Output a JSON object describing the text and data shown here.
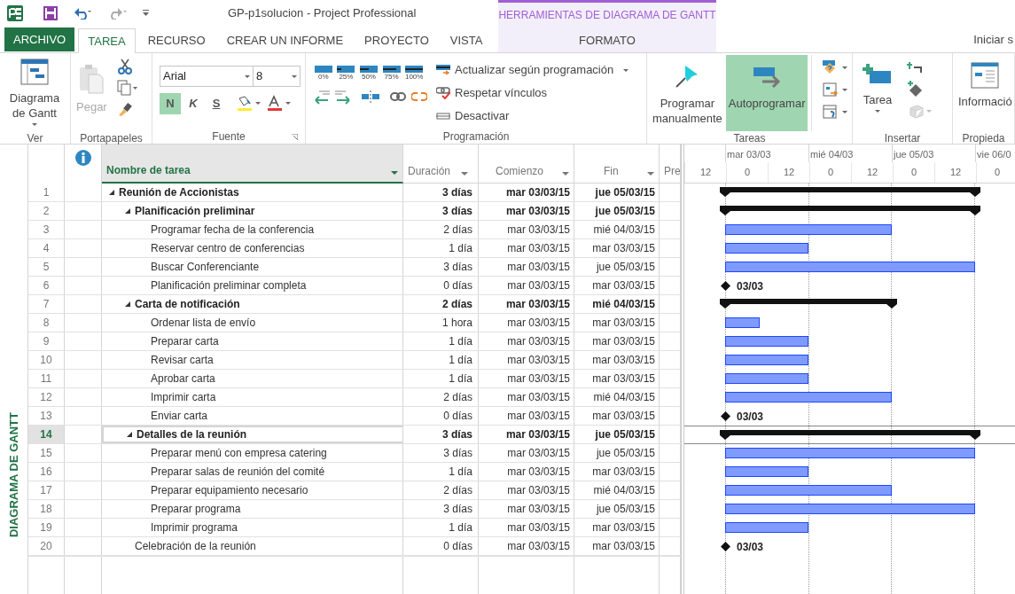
{
  "window": {
    "title": "GP-p1solucion - Project Professional"
  },
  "contextual_group": {
    "label": "HERRAMIENTAS DE DIAGRAMA DE GANTT"
  },
  "tabs": [
    {
      "label": "ARCHIVO",
      "kind": "file",
      "selected": false
    },
    {
      "label": "TAREA",
      "kind": "main",
      "selected": true
    },
    {
      "label": "RECURSO",
      "kind": "main",
      "selected": false
    },
    {
      "label": "CREAR UN INFORME",
      "kind": "main",
      "selected": false
    },
    {
      "label": "PROYECTO",
      "kind": "main",
      "selected": false
    },
    {
      "label": "VISTA",
      "kind": "main",
      "selected": false
    },
    {
      "label": "FORMATO",
      "kind": "contextual",
      "selected": false
    }
  ],
  "account_link": "Iniciar s",
  "ribbon_groups": [
    {
      "kind": "view",
      "label": "Ver",
      "buttons": [
        {
          "label": "Diagrama de Gantt",
          "dropdown": true
        }
      ]
    },
    {
      "kind": "clipboard",
      "label": "Portapapeles",
      "buttons": [
        {
          "label": "Pegar",
          "disabled": true
        }
      ]
    },
    {
      "kind": "font",
      "label": "Fuente",
      "font": "Arial",
      "size": "8",
      "styles": [
        {
          "label": "N",
          "selected": true
        },
        {
          "label": "K",
          "selected": false
        },
        {
          "label": "S",
          "selected": false
        }
      ]
    },
    {
      "kind": "schedule",
      "label": "Programación",
      "percents": [
        "0%",
        "25%",
        "50%",
        "75%",
        "100%"
      ],
      "commands": [
        {
          "label": "Actualizar según programación",
          "dropdown": true
        },
        {
          "label": "Respetar vínculos",
          "dropdown": false
        },
        {
          "label": "Desactivar",
          "dropdown": false
        }
      ]
    },
    {
      "kind": "tasks",
      "label": "Tareas",
      "buttons": [
        {
          "label": "Programar manualmente",
          "selected": false
        },
        {
          "label": "Autoprogramar",
          "selected": true
        }
      ]
    },
    {
      "kind": "insert",
      "label": "Insertar",
      "buttons": [
        {
          "label": "Tarea",
          "dropdown": true
        }
      ]
    },
    {
      "kind": "properties",
      "label": "Propieda",
      "buttons": [
        {
          "label": "Informació"
        }
      ]
    }
  ],
  "side_label": "DIAGRAMA DE GANTT",
  "columns": [
    {
      "label": "Nombre de tarea",
      "selected": true,
      "dropdown": true
    },
    {
      "label": "Duración",
      "selected": false,
      "dropdown": true
    },
    {
      "label": "Comienzo",
      "selected": false,
      "dropdown": true
    },
    {
      "label": "Fin",
      "selected": false,
      "dropdown": true
    },
    {
      "label": "Pre",
      "selected": false
    }
  ],
  "timescale": {
    "days": [
      "mar 03/03",
      "mié 04/03",
      "jue 05/03",
      "vie 06/0"
    ],
    "hours": [
      "12",
      "0",
      "12",
      "0",
      "12",
      "0",
      "12",
      "0"
    ]
  },
  "rows": [
    {
      "id": "1",
      "name": "Reunión de Accionistas",
      "duration": "3 días",
      "start": "mar 03/03/15",
      "finish": "jue 05/03/15",
      "kind": "summary",
      "expanded": true,
      "selected": false,
      "children": [
        {
          "id": "2",
          "name": "Planificación preliminar",
          "duration": "3 días",
          "start": "mar 03/03/15",
          "finish": "jue 05/03/15",
          "kind": "summary",
          "expanded": true,
          "selected": false,
          "children": [
            {
              "id": "3",
              "name": "Programar fecha de la conferencia",
              "duration": "2 días",
              "start": "mar 03/03/15",
              "finish": "mié 04/03/15",
              "kind": "task",
              "selected": false
            },
            {
              "id": "4",
              "name": "Reservar centro de conferencias",
              "duration": "1 día",
              "start": "mar 03/03/15",
              "finish": "mar 03/03/15",
              "kind": "task",
              "selected": false
            },
            {
              "id": "5",
              "name": "Buscar Conferenciante",
              "duration": "3 días",
              "start": "mar 03/03/15",
              "finish": "jue 05/03/15",
              "kind": "task",
              "selected": false
            },
            {
              "id": "6",
              "name": "Planificación preliminar completa",
              "duration": "0 días",
              "start": "mar 03/03/15",
              "finish": "mar 03/03/15",
              "kind": "milestone",
              "bar_label": "03/03",
              "selected": false
            }
          ]
        },
        {
          "id": "7",
          "name": "Carta de notificación",
          "duration": "2 días",
          "start": "mar 03/03/15",
          "finish": "mié 04/03/15",
          "kind": "summary",
          "expanded": true,
          "selected": false,
          "children": [
            {
              "id": "8",
              "name": "Ordenar lista de envío",
              "duration": "1 hora",
              "start": "mar 03/03/15",
              "finish": "mar 03/03/15",
              "kind": "task",
              "selected": false
            },
            {
              "id": "9",
              "name": "Preparar carta",
              "duration": "1 día",
              "start": "mar 03/03/15",
              "finish": "mar 03/03/15",
              "kind": "task",
              "selected": false
            },
            {
              "id": "10",
              "name": "Revisar carta",
              "duration": "1 día",
              "start": "mar 03/03/15",
              "finish": "mar 03/03/15",
              "kind": "task",
              "selected": false
            },
            {
              "id": "11",
              "name": "Aprobar carta",
              "duration": "1 día",
              "start": "mar 03/03/15",
              "finish": "mar 03/03/15",
              "kind": "task",
              "selected": false
            },
            {
              "id": "12",
              "name": "Imprimir carta",
              "duration": "2 días",
              "start": "mar 03/03/15",
              "finish": "mié 04/03/15",
              "kind": "task",
              "selected": false
            },
            {
              "id": "13",
              "name": "Enviar carta",
              "duration": "0 días",
              "start": "mar 03/03/15",
              "finish": "mar 03/03/15",
              "kind": "milestone",
              "bar_label": "03/03",
              "selected": false
            }
          ]
        },
        {
          "id": "14",
          "name": "Detalles de la reunión",
          "duration": "3 días",
          "start": "mar 03/03/15",
          "finish": "jue 05/03/15",
          "kind": "summary",
          "expanded": true,
          "selected": true,
          "children": [
            {
              "id": "15",
              "name": "Preparar menú con empresa catering",
              "duration": "3 días",
              "start": "mar 03/03/15",
              "finish": "jue 05/03/15",
              "kind": "task",
              "selected": false
            },
            {
              "id": "16",
              "name": "Preparar salas de reunión del comité",
              "duration": "1 día",
              "start": "mar 03/03/15",
              "finish": "mar 03/03/15",
              "kind": "task",
              "selected": false
            },
            {
              "id": "17",
              "name": "Preparar equipamiento necesario",
              "duration": "2 días",
              "start": "mar 03/03/15",
              "finish": "mié 04/03/15",
              "kind": "task",
              "selected": false
            },
            {
              "id": "18",
              "name": "Preparar programa",
              "duration": "3 días",
              "start": "mar 03/03/15",
              "finish": "jue 05/03/15",
              "kind": "task",
              "selected": false
            },
            {
              "id": "19",
              "name": "Imprimir programa",
              "duration": "1 día",
              "start": "mar 03/03/15",
              "finish": "mar 03/03/15",
              "kind": "task",
              "selected": false
            }
          ]
        },
        {
          "id": "20",
          "name": "Celebración de la reunión",
          "duration": "0 días",
          "start": "mar 03/03/15",
          "finish": "mar 03/03/15",
          "kind": "milestone",
          "bar_label": "03/03",
          "selected": false
        }
      ]
    }
  ]
}
